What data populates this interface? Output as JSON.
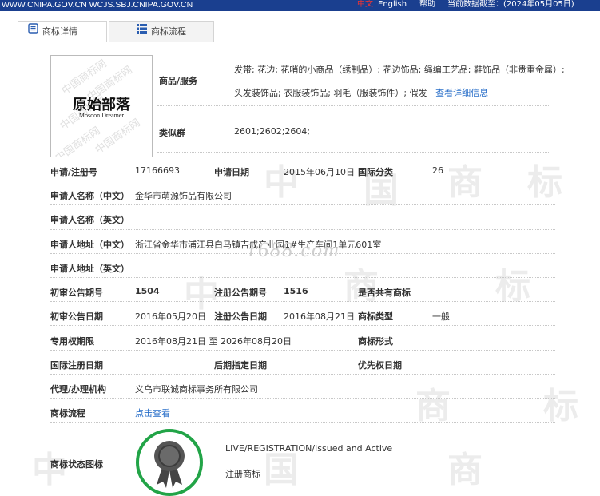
{
  "topbar": {
    "url": "WWW.CNIPA.GOV.CN WCJS.SBJ.CNIPA.GOV.CN",
    "lang_zh": "中文",
    "lang_en": "English",
    "help": "帮助",
    "date_note": "当前数据截至：(2024年05月05日)"
  },
  "tabs": [
    {
      "label": "商标详情"
    },
    {
      "label": "商标流程"
    }
  ],
  "logo": {
    "main": "原始部落",
    "sub": "Mosoon Dreamer",
    "watermark": "中国商标网"
  },
  "site_watermark": "1688.com",
  "goods": {
    "label": "商品/服务",
    "line1": "发带; 花边; 花哨的小商品（绣制品）; 花边饰品; 绳编工艺品; 鞋饰品（非贵重金属）;",
    "line2": "头发装饰品; 衣服装饰品; 羽毛（服装饰件）; 假发",
    "detail_link": "查看详细信息"
  },
  "similar_group": {
    "label": "类似群",
    "value": "2601;2602;2604;"
  },
  "fields": {
    "reg_no_label": "申请/注册号",
    "reg_no": "17166693",
    "app_date_label": "申请日期",
    "app_date": "2015年06月10日",
    "intl_class_label": "国际分类",
    "intl_class": "26",
    "applicant_cn_label": "申请人名称（中文）",
    "applicant_cn": "金华市萌源饰品有限公司",
    "applicant_en_label": "申请人名称（英文）",
    "applicant_en": "",
    "address_cn_label": "申请人地址（中文）",
    "address_cn": "浙江省金华市浦江县白马镇吉成产业园1#生产车间1单元601室",
    "address_en_label": "申请人地址（英文）",
    "address_en": "",
    "prelim_no_label": "初审公告期号",
    "prelim_no": "1504",
    "reg_pub_no_label": "注册公告期号",
    "reg_pub_no": "1516",
    "shared_label": "是否共有商标",
    "shared": "",
    "prelim_date_label": "初审公告日期",
    "prelim_date": "2016年05月20日",
    "reg_pub_date_label": "注册公告日期",
    "reg_pub_date": "2016年08月21日",
    "tm_type_label": "商标类型",
    "tm_type": "一般",
    "term_label": "专用权期限",
    "term": "2016年08月21日 至 2026年08月20日",
    "tm_form_label": "商标形式",
    "tm_form": "",
    "intl_reg_date_label": "国际注册日期",
    "intl_reg_date": "",
    "later_date_label": "后期指定日期",
    "later_date": "",
    "priority_date_label": "优先权日期",
    "priority_date": "",
    "agent_label": "代理/办理机构",
    "agent": "义乌市联诚商标事务所有限公司",
    "process_label": "商标流程",
    "process_link": "点击查看",
    "status_label": "商标状态图标",
    "status_en": "LIVE/REGISTRATION/Issued and Active",
    "status_cn": "注册商标"
  },
  "colors": {
    "topbar": "#1a3f8f",
    "link": "#2a6fc9",
    "badge_ring": "#22a447",
    "badge_seal": "#555555"
  }
}
